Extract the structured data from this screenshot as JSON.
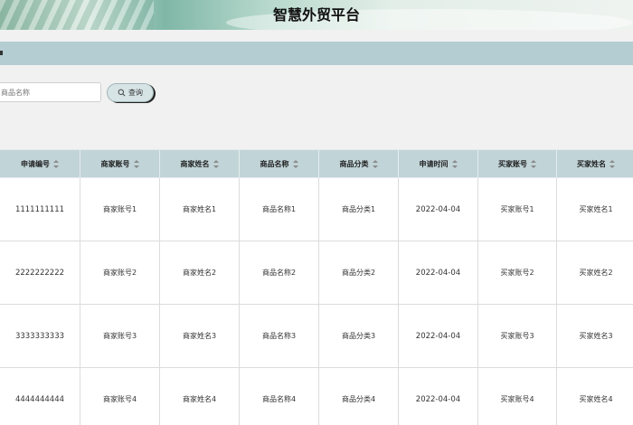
{
  "header": {
    "title": "智慧外贸平台"
  },
  "search": {
    "placeholder": "商品名称",
    "button_label": "查询"
  },
  "table": {
    "columns": [
      "申请编号",
      "商家账号",
      "商家姓名",
      "商品名称",
      "商品分类",
      "申请时间",
      "买家账号",
      "买家姓名"
    ],
    "rows": [
      [
        "1111111111",
        "商家账号1",
        "商家姓名1",
        "商品名称1",
        "商品分类1",
        "2022-04-04",
        "买家账号1",
        "买家姓名1"
      ],
      [
        "2222222222",
        "商家账号2",
        "商家姓名2",
        "商品名称2",
        "商品分类2",
        "2022-04-04",
        "买家账号2",
        "买家姓名2"
      ],
      [
        "3333333333",
        "商家账号3",
        "商家姓名3",
        "商品名称3",
        "商品分类3",
        "2022-04-04",
        "买家账号3",
        "买家姓名3"
      ],
      [
        "4444444444",
        "商家账号4",
        "商家姓名4",
        "商品名称4",
        "商品分类4",
        "2022-04-04",
        "买家账号4",
        "买家姓名4"
      ]
    ]
  }
}
